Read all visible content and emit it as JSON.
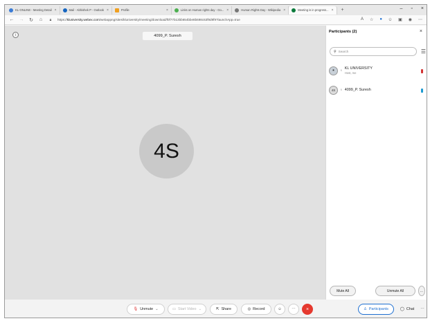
{
  "browser": {
    "tabs": [
      {
        "label": "KL-ONLINE - Meeting Detail",
        "fav": "#3a7bd5",
        "active": false
      },
      {
        "label": "Mail - Abhishek P - Outlook",
        "fav": "#1565c0",
        "active": false
      },
      {
        "label": "Profile",
        "fav": "#f0a020",
        "active": false
      },
      {
        "label": "Links on Human rights day - Go...",
        "fav": "#4caf50",
        "active": false
      },
      {
        "label": "Human Rights Day - Wikipedia",
        "fav": "#777777",
        "active": false
      },
      {
        "label": "Meeting is in progress...",
        "fav": "#0b7a3b",
        "active": true
      }
    ],
    "url_prefix": "https://",
    "url_host": "kluniversity.webex.com",
    "url_path": "/webappng/sites/kluniversity/meeting/download/f0f77b13bb654bbe8b698c63f9d9f9?launchApp=true"
  },
  "meeting": {
    "participant_name_label": "4099_P. Suresh",
    "avatar_initials": "4S"
  },
  "participants_panel": {
    "title": "Participants (2)",
    "search_placeholder": "Search",
    "participants": [
      {
        "name": "KL UNIVERSITY",
        "sub": "Host, me",
        "initials": "",
        "status_color": "#d33333"
      },
      {
        "name": "4099_P. Suresh",
        "sub": "",
        "initials": "4S",
        "status_color": "#1d9bd1"
      }
    ],
    "mute_all_label": "Mute All",
    "unmute_all_label": "Unmute All"
  },
  "controls": {
    "unmute_label": "Unmute",
    "start_video_label": "Start Video",
    "share_label": "Share",
    "record_label": "Record",
    "participants_label": "Participants",
    "chat_label": "Chat"
  }
}
